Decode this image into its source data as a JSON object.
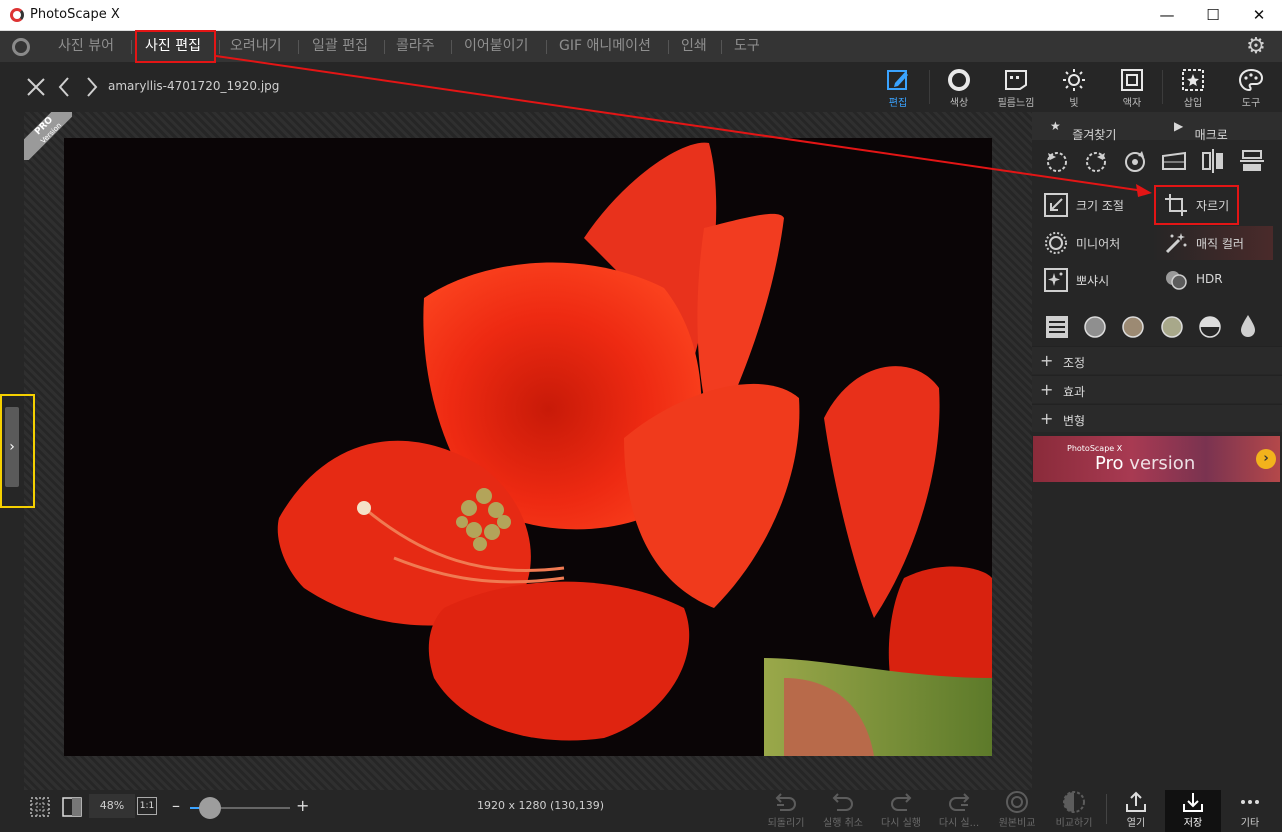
{
  "window": {
    "title": "PhotoScape X",
    "minimize": "—",
    "maximize": "☐",
    "close": "✕"
  },
  "menu": {
    "items": [
      "사진 뷰어",
      "사진 편집",
      "오려내기",
      "일괄 편집",
      "콜라주",
      "이어붙이기",
      "GIF 애니메이션",
      "인쇄",
      "도구"
    ],
    "active": "사진 편집"
  },
  "toolbar": {
    "filename": "amaryllis-4701720_1920.jpg",
    "tools": [
      "편집",
      "색상",
      "필름느낌",
      "빛",
      "액자",
      "삽입",
      "도구"
    ],
    "active_tool": "편집"
  },
  "canvas": {
    "pro_badge": "PRO",
    "pro_badge_sub": "Version"
  },
  "panel": {
    "favorites": "즐겨찾기",
    "macro": "매크로",
    "buttons": {
      "resize": "크기 조절",
      "crop": "자르기",
      "miniature": "미니어처",
      "magic_color": "매직 컬러",
      "bokeh": "뽀샤시",
      "hdr": "HDR"
    },
    "sections": [
      "조정",
      "효과",
      "변형"
    ],
    "banner_small": "PhotoScape X",
    "banner_pro": "Pro",
    "banner_version": "version"
  },
  "bottom": {
    "zoom": "48%",
    "one_to_one": "1:1",
    "zoom_level": 0.2,
    "dimensions": "1920 x 1280 (130,139)",
    "actions": [
      "되돌리기",
      "실행 취소",
      "다시 실행",
      "다시 실...",
      "원본비교",
      "비교하기"
    ],
    "open": "열기",
    "save": "저장",
    "more": "기타"
  },
  "colors": {
    "accent": "#3aa3ff",
    "annotation_red": "#e31515",
    "annotation_yellow": "#f5d000"
  }
}
